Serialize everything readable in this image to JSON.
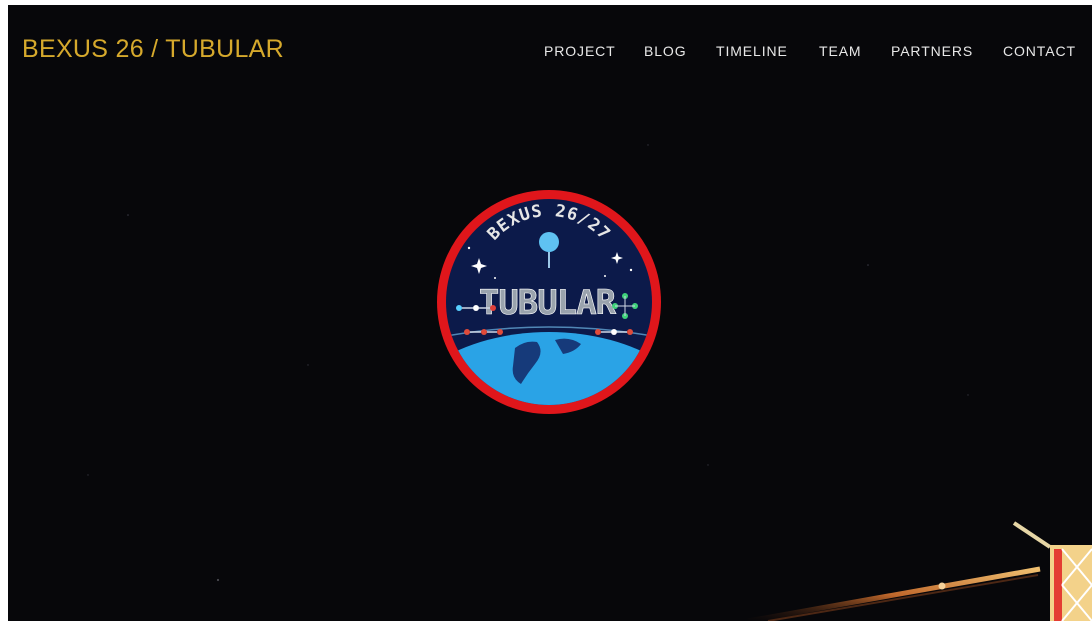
{
  "site": {
    "title": "BEXUS 26 / TUBULAR"
  },
  "nav": {
    "items": [
      {
        "label": "PROJECT"
      },
      {
        "label": "BLOG"
      },
      {
        "label": "TIMELINE"
      },
      {
        "label": "TEAM"
      },
      {
        "label": "PARTNERS"
      },
      {
        "label": "CONTACT"
      }
    ]
  },
  "hero": {
    "logo_ring_text": "BEXUS 26/27",
    "logo_wordmark": "TUBULAR",
    "background_icon": "night-sky-balloon-launch"
  },
  "colors": {
    "background": "#07070a",
    "title": "#d6a92c",
    "nav_text": "#e8e8e8",
    "logo_ring": "#e0161b",
    "logo_inner": "#0c1a4a",
    "earth": "#2aa3e6"
  }
}
